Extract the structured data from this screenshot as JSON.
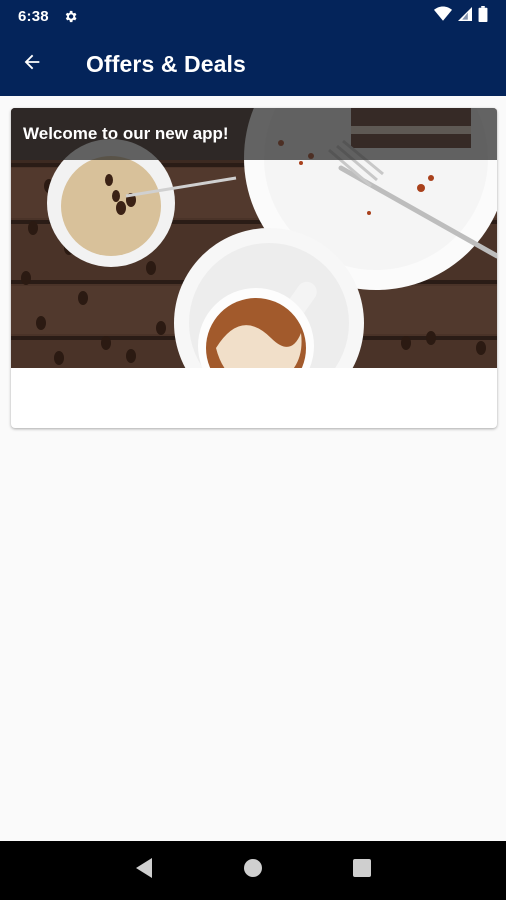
{
  "status_bar": {
    "time": "6:38",
    "icons": [
      "settings-gear-icon",
      "wifi-icon",
      "cell-signal-icon",
      "battery-icon"
    ]
  },
  "app_bar": {
    "title": "Offers & Deals",
    "back_icon": "arrow-left-icon",
    "background_color": "#04245a"
  },
  "offers": [
    {
      "caption": "Welcome to our new app!",
      "image": "coffee-and-dessert-photo"
    }
  ],
  "nav_bar": {
    "buttons": [
      "back-triangle-icon",
      "home-circle-icon",
      "recents-square-icon"
    ]
  }
}
